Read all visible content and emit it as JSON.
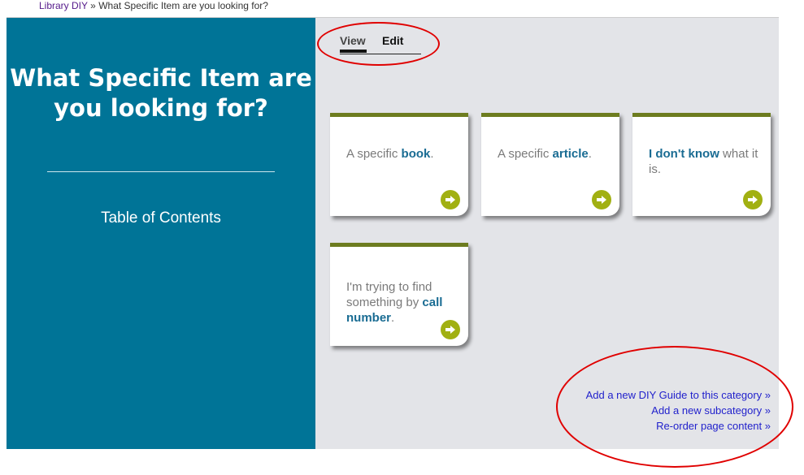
{
  "breadcrumb": {
    "link": "Library DIY",
    "separator": "»",
    "current": "What Specific Item are you looking for?"
  },
  "sidebar": {
    "title": "What Specific Item are you looking for?",
    "toc": "Table of Contents"
  },
  "tabs": {
    "view": "View",
    "edit": "Edit"
  },
  "cards": [
    {
      "pre": "A specific ",
      "bold": "book",
      "post": "."
    },
    {
      "pre": "A specific ",
      "bold": "article",
      "post": "."
    },
    {
      "pre": "",
      "bold": "I don't know",
      "post": " what it is."
    },
    {
      "pre": "I'm trying to find something by ",
      "bold": "call number",
      "post": "."
    }
  ],
  "admin_links": {
    "add_guide": "Add a new DIY Guide to this category »",
    "add_subcategory": "Add a new subcategory »",
    "reorder": "Re-order page content »"
  },
  "colors": {
    "sidebar": "#007497",
    "accent_bar": "#6d7c1f",
    "arrow": "#a1b012",
    "annotation": "#e00000"
  }
}
